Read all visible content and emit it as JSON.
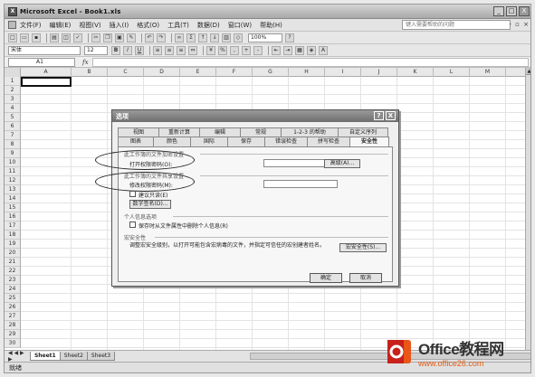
{
  "window": {
    "title": "Microsoft Excel - Book1.xls",
    "controls": [
      "_",
      "□",
      "X"
    ]
  },
  "menubar": {
    "items": [
      "文件(F)",
      "编辑(E)",
      "视图(V)",
      "插入(I)",
      "格式(O)",
      "工具(T)",
      "数据(D)",
      "窗口(W)",
      "帮助(H)"
    ],
    "help_placeholder": "键入需要帮助的问题",
    "mdi_controls": "- ▫ ×"
  },
  "toolbar": {
    "zoom": "100%",
    "font_name": "宋体",
    "font_size": "12"
  },
  "formula_bar": {
    "name_box": "A1",
    "fx": "fx"
  },
  "grid": {
    "columns": [
      "A",
      "B",
      "C",
      "D",
      "E",
      "F",
      "G",
      "H",
      "I",
      "J",
      "K",
      "L",
      "M"
    ],
    "rows": [
      "1",
      "2",
      "3",
      "4",
      "5",
      "6",
      "7",
      "8",
      "9",
      "10",
      "11",
      "12",
      "13",
      "14",
      "15",
      "16",
      "17",
      "18",
      "19",
      "20",
      "21",
      "22",
      "23",
      "24",
      "25",
      "26",
      "27",
      "28",
      "29",
      "30"
    ]
  },
  "sheet_tabs": {
    "nav": "◀ ◀ ▶ ▶",
    "tabs": [
      "Sheet1",
      "Sheet2",
      "Sheet3"
    ]
  },
  "status": {
    "text": "就绪"
  },
  "dialog": {
    "title": "选项",
    "title_buttons": [
      "?",
      "X"
    ],
    "tabs_row1": [
      "视图",
      "重新计算",
      "编辑",
      "常规",
      "1-2-3 的帮助",
      "自定义序列"
    ],
    "tabs_row2": [
      "图表",
      "颜色",
      "国际",
      "保存",
      "错误检查",
      "拼写检查",
      "安全性"
    ],
    "active_tab": "安全性",
    "section_encrypt": "此工作簿的文件加密设置",
    "open_password_label": "打开权限密码(O):",
    "advanced_button": "高级(A)...",
    "section_share": "此工作簿的文件共享设置",
    "modify_password_label": "修改权限密码(M):",
    "readonly_label": "建议只读(E)",
    "signature_button": "数字签名(D)...",
    "section_privacy": "个人信息选项",
    "privacy_checkbox": "保存时从文件属性中删除个人信息(R)",
    "section_macro": "宏安全性",
    "macro_text": "调整宏安全级别，以打开可能包含宏病毒的文件，并指定可信任的宏创建者姓名。",
    "macro_button": "宏安全性(S)...",
    "ok": "确定",
    "cancel": "取消"
  },
  "watermark": {
    "title": "Office教程网",
    "url": "www.office26.com"
  },
  "colors": {
    "watermark_orange": "#e8561a",
    "watermark_red": "#c8201b"
  }
}
